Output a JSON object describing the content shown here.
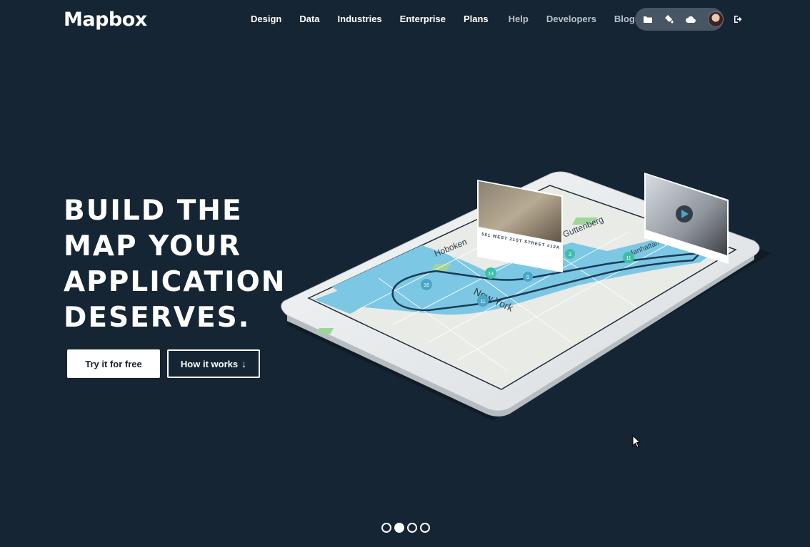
{
  "brand": {
    "logo_text": "Mapbox"
  },
  "nav": {
    "items": [
      "Design",
      "Data",
      "Industries",
      "Enterprise",
      "Plans"
    ],
    "secondary_items": [
      "Help",
      "Developers",
      "Blog"
    ]
  },
  "user_menu": {
    "icons": [
      "folder-icon",
      "paint-bucket-icon",
      "cloud-icon"
    ],
    "avatar": "user-avatar"
  },
  "hero": {
    "headline_lines": [
      "BUILD THE",
      "MAP YOUR",
      "APPLICATION",
      "DESERVES."
    ],
    "primary_button": "Try it for free",
    "secondary_button": "How it works",
    "secondary_button_icon": "↓"
  },
  "map_labels": {
    "listing_address": "551 WEST 21ST STREET #12A",
    "neighborhood_1": "Hoboken",
    "neighborhood_2": "Guttenberg",
    "neighborhood_3": "Manhattan",
    "city": "New York",
    "markers": [
      "16",
      "13",
      "11",
      "9",
      "3",
      "11"
    ]
  },
  "pager": {
    "count": 4,
    "active_index": 1
  },
  "colors": {
    "background": "#162534",
    "pill": "#475564",
    "water": "#7cc7e4",
    "marker": "#3bbfa8"
  }
}
